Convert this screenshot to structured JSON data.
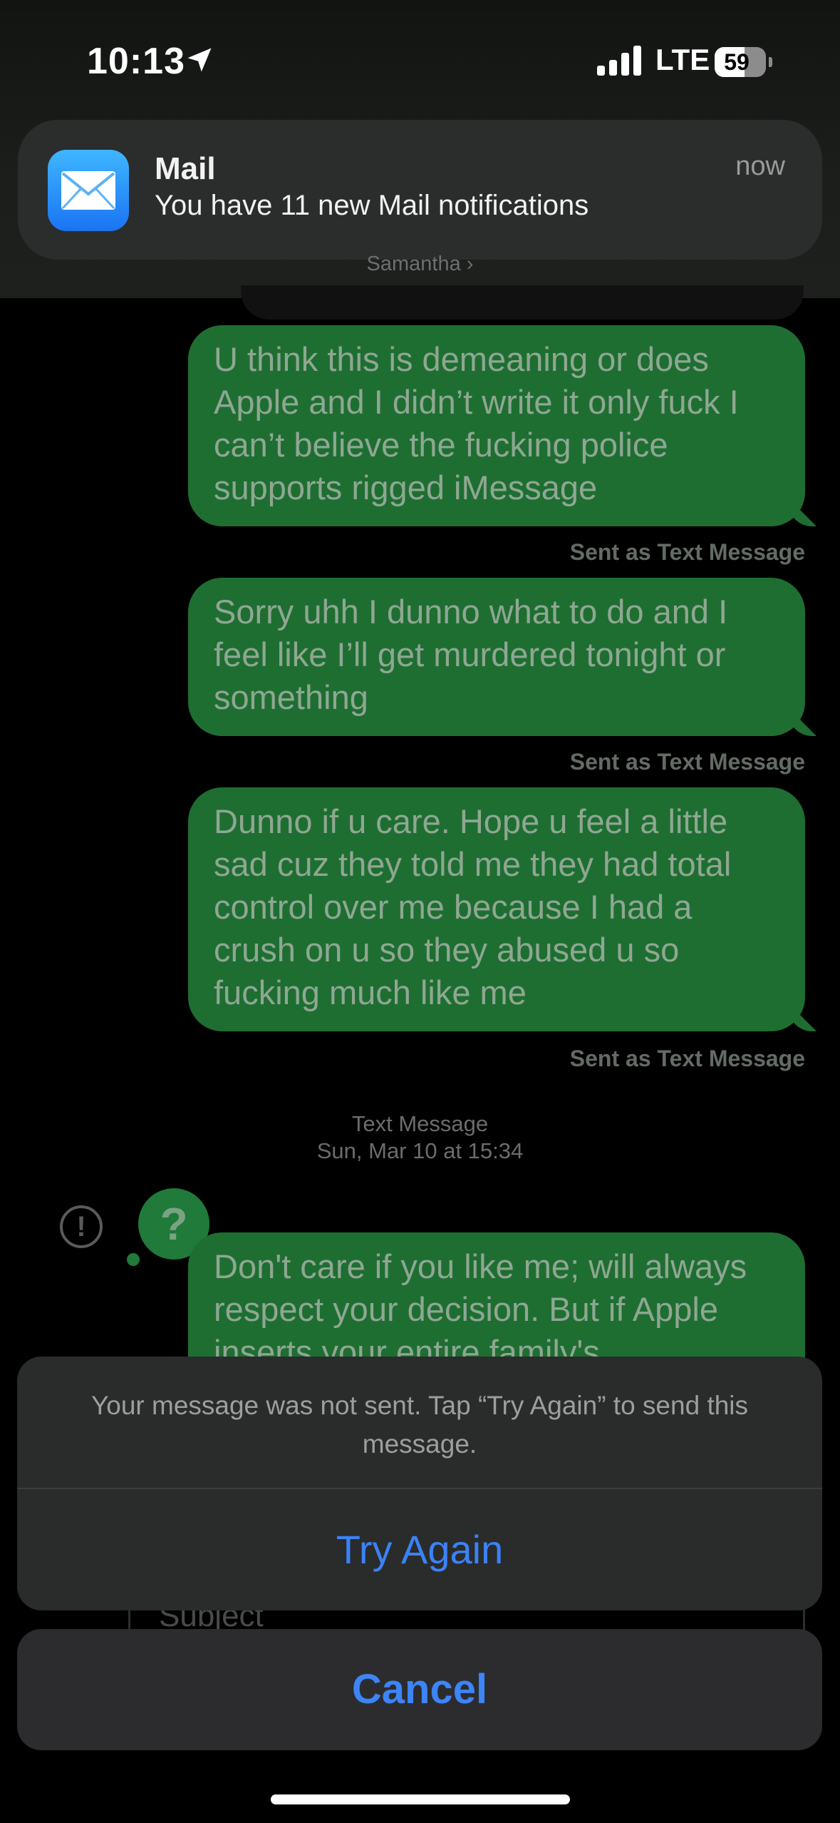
{
  "status_bar": {
    "time": "10:13",
    "network": "LTE",
    "battery": "59",
    "battery_level_percent": 59,
    "location_icon": "location-arrow-icon"
  },
  "notification": {
    "app": "Mail",
    "body": "You have 11 new Mail notifications",
    "time": "now",
    "icon": "mail-envelope-icon",
    "accent": "#1a74f2"
  },
  "conversation": {
    "contact": "Samantha ›",
    "messages": [
      {
        "text": "U think this is demeaning or does Apple and I didn’t write it only fuck I can’t believe the fucking police supports rigged iMessage",
        "note": "Sent as Text Message"
      },
      {
        "text": "Sorry uhh I dunno what to do and I feel like I’ll get murdered tonight or something",
        "note": "Sent as Text Message"
      },
      {
        "text": "Dunno if u care. Hope u feel a little sad cuz they told me they had total control over me because I had a crush on u so they abused u so fucking much like me",
        "note": "Sent as Text Message"
      }
    ],
    "timestamp": {
      "type": "Text Message",
      "date": "Sun, Mar 10 at 15:34"
    },
    "failed_message": "Don't care if you like me; will always respect your decision. But if Apple inserts your entire family's",
    "subject_placeholder": "Subject",
    "bubble_color": "#1e6e32"
  },
  "action_sheet": {
    "message": "Your message was not sent. Tap “Try Again” to send this message.",
    "try_again": "Try Again",
    "cancel": "Cancel",
    "button_color": "#3b82f6"
  }
}
